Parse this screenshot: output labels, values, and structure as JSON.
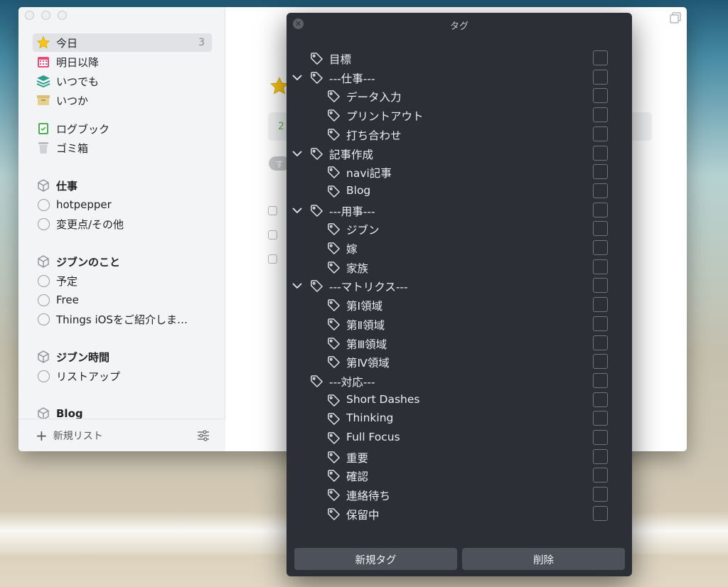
{
  "sidebar": {
    "nav": [
      {
        "label": "今日",
        "count": "3",
        "icon": "star-icon"
      },
      {
        "label": "明日以降",
        "icon": "calendar-icon"
      },
      {
        "label": "いつでも",
        "icon": "layers-icon"
      },
      {
        "label": "いつか",
        "icon": "archive-box-icon"
      },
      {
        "label": "ログブック",
        "icon": "logbook-icon"
      },
      {
        "label": "ゴミ箱",
        "icon": "trash-icon"
      }
    ],
    "areas": [
      {
        "title": "仕事",
        "projects": [
          "hotpepper",
          "変更点/その他"
        ]
      },
      {
        "title": "ジブンのこと",
        "projects": [
          "予定",
          "Free",
          "Things iOSをご紹介しま…"
        ]
      },
      {
        "title": "ジブン時間",
        "projects": [
          "リストアップ"
        ]
      },
      {
        "title": "Blog",
        "projects": []
      }
    ],
    "footer": {
      "new_list": "新規リスト"
    }
  },
  "content": {
    "banner_text": "2",
    "pill_text": "す"
  },
  "tag_dialog": {
    "title": "タグ",
    "tags": [
      {
        "label": "目標",
        "level": 0,
        "expandable": false
      },
      {
        "label": "---仕事---",
        "level": 0,
        "expandable": true
      },
      {
        "label": "データ入力",
        "level": 1,
        "expandable": false
      },
      {
        "label": "プリントアウト",
        "level": 1,
        "expandable": false
      },
      {
        "label": "打ち合わせ",
        "level": 1,
        "expandable": false
      },
      {
        "label": "記事作成",
        "level": 0,
        "expandable": true
      },
      {
        "label": "navi記事",
        "level": 1,
        "expandable": false
      },
      {
        "label": "Blog",
        "level": 1,
        "expandable": false
      },
      {
        "label": "---用事---",
        "level": 0,
        "expandable": true
      },
      {
        "label": "ジブン",
        "level": 1,
        "expandable": false
      },
      {
        "label": "嫁",
        "level": 1,
        "expandable": false
      },
      {
        "label": "家族",
        "level": 1,
        "expandable": false
      },
      {
        "label": "---マトリクス---",
        "level": 0,
        "expandable": true
      },
      {
        "label": "第Ⅰ領域",
        "level": 1,
        "expandable": false
      },
      {
        "label": "第Ⅱ領域",
        "level": 1,
        "expandable": false
      },
      {
        "label": "第Ⅲ領域",
        "level": 1,
        "expandable": false
      },
      {
        "label": "第Ⅳ領域",
        "level": 1,
        "expandable": false
      },
      {
        "label": "---対応---",
        "level": 0,
        "expandable": false
      },
      {
        "label": "Short Dashes",
        "level": 1,
        "expandable": false
      },
      {
        "label": "Thinking",
        "level": 1,
        "expandable": false
      },
      {
        "label": "Full Focus",
        "level": 1,
        "expandable": false
      },
      {
        "label": "重要",
        "level": 1,
        "expandable": false
      },
      {
        "label": "確認",
        "level": 1,
        "expandable": false
      },
      {
        "label": "連絡待ち",
        "level": 1,
        "expandable": false
      },
      {
        "label": "保留中",
        "level": 1,
        "expandable": false
      }
    ],
    "new_tag_button": "新規タグ",
    "delete_button": "削除"
  },
  "colors": {
    "dialog_bg": "#2c2f36",
    "today_star": "#f5c518",
    "banner_text": "#63b84b"
  }
}
